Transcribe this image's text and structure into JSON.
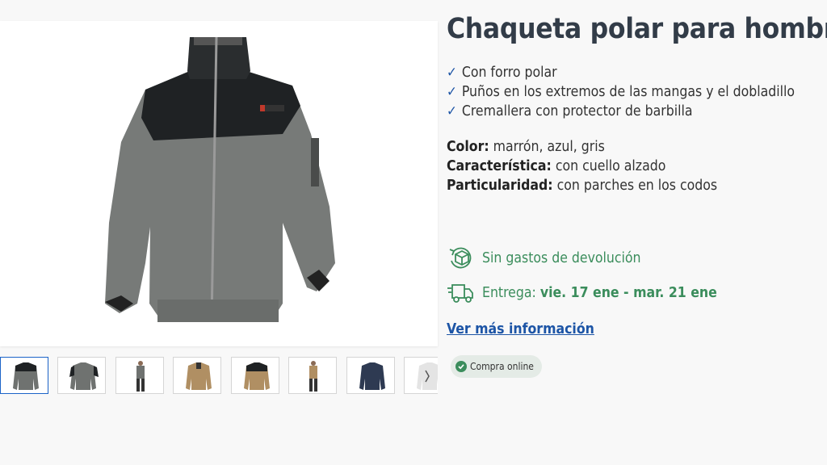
{
  "product": {
    "title": "Chaqueta polar para hombre",
    "features": [
      "Con forro polar",
      "Puños en los extremos de las mangas y el dobladillo",
      "Cremallera con protector de barbilla"
    ],
    "specs": [
      {
        "label": "Color:",
        "value": "marrón, azul, gris"
      },
      {
        "label": "Característica:",
        "value": "con cuello alzado"
      },
      {
        "label": "Particularidad:",
        "value": "con parches en los codos"
      }
    ]
  },
  "services": {
    "returns_text": "Sin gastos de devolución",
    "delivery_label": "Entrega:",
    "delivery_dates": "vie. 17 ene - mar. 21 ene"
  },
  "links": {
    "more_info": "Ver más información"
  },
  "badge": {
    "online_label": "Compra online"
  },
  "icons": {
    "check": "✓",
    "returns": "box-return-icon",
    "delivery": "truck-icon",
    "badge": "check-circle-icon"
  },
  "colors": {
    "title": "#323c48",
    "accent_blue": "#1d55a6",
    "service_green": "#3b8d5c",
    "badge_bg": "#e4ebe6"
  }
}
